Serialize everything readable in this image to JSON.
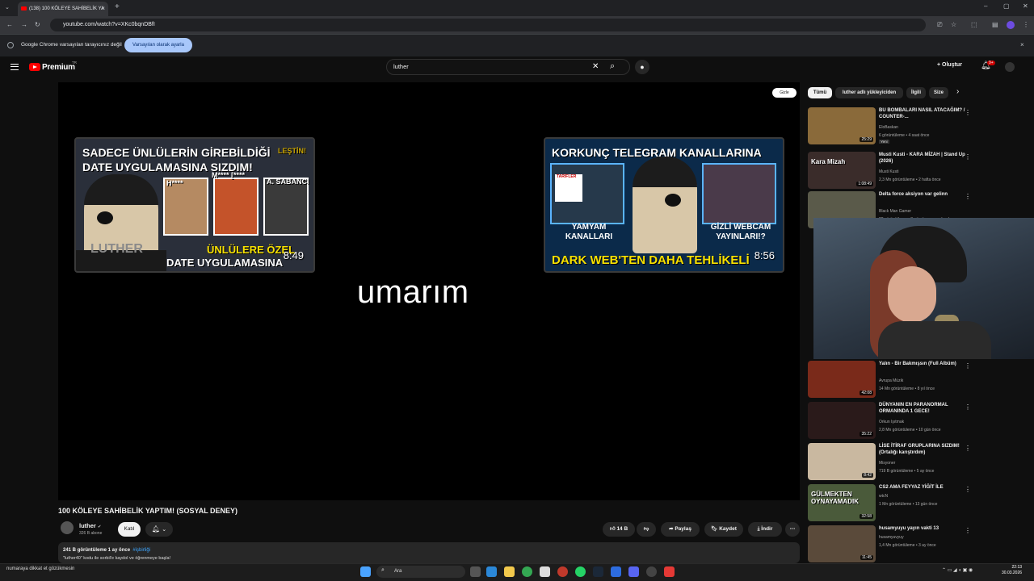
{
  "browser": {
    "tab_title": "(138) 100 KÖLEYE SAHİBELİK YA",
    "tab_close": "×",
    "new_tab": "+",
    "url": "youtube.com/watch?v=XKc0bqnDBfI",
    "infobar_text": "Google Chrome varsayılan tarayıcınız değil",
    "infobar_button": "Varsayılan olarak ayarla",
    "infobar_close": "×",
    "window_controls": {
      "minimize": "–",
      "maximize": "▢",
      "close": "✕"
    }
  },
  "header": {
    "brand": "Premium",
    "region": "TR",
    "search_value": "luther",
    "create_label": "Oluştur",
    "notif_count": "9+"
  },
  "player": {
    "hide_label": "Gizle",
    "caption": "umarım",
    "card1": {
      "title": "SADECE ÜNLÜLERİN GİREBİLDİĞİ DATE UYGULAMASINA SIZDIM!",
      "corner": "LEŞTİN!",
      "face_label": "LUTHER",
      "p1": "H****",
      "p2": "M**** [****",
      "p3": "A. SABANCI",
      "bottom1": "ÜNLÜLERE ÖZEL",
      "bottom2": "DATE UYGULAMASINA SIZDIM!",
      "duration": "8:49"
    },
    "card2": {
      "title": "KORKUNÇ TELEGRAM KANALLARINA SIZDIM!",
      "tile1": "YAMYAM KANALLARI",
      "tile2": "GİZLİ WEBCAM YAYINLARI!?",
      "tile_tag": "TARİFLER",
      "bottom": "DARK WEB'TEN DAHA TEHLİKELİ",
      "duration": "8:56"
    }
  },
  "video": {
    "title": "100 KÖLEYE SAHİBELİK YAPTIM! (SOSYAL DENEY)",
    "channel": "luther",
    "subs": "326 B abone",
    "join": "Katıl",
    "likes": "14 B",
    "share": "Paylaş",
    "save": "Kaydet",
    "download": "İndir",
    "more": "⋯",
    "desc_stats": "241 B görüntüleme  1 ay önce",
    "desc_tag": "#işbirliği",
    "desc_line": "\"luther40\" kodu ile sorbil'e kaydol ve öğrenmeye başla!"
  },
  "chips": [
    "Tümü",
    "luther adlı yükleyiciden",
    "İlgili",
    "Size"
  ],
  "recommendations": [
    {
      "title": "BU BOMBALARI NASIL ATACAĞIM? / COUNTER-...",
      "channel": "EloBaskan",
      "meta": "6 görüntüleme • 4 saat önce",
      "badge": "Yeni",
      "duration": "25:29",
      "color": "#8a6a3a"
    },
    {
      "title": "Musti Kusti - KARA MİZAH | Stand Up (2026)",
      "channel": "Musti Kusti",
      "meta": "2,3 Mn görüntüleme • 2 hafta önce",
      "badge": "",
      "duration": "1:08:49",
      "color": "#3a2c2a",
      "thumb_text": "Kara Mizah"
    },
    {
      "title": "Delta force aksiyon var gelinn",
      "channel": "Black Man Gamer",
      "meta": "28 görüntüleme • 3 gün önce yayınlandı",
      "badge": "",
      "duration": "",
      "color": "#5a5a4a"
    },
    {
      "title": "Yalın - Bir Bakmışsın (Full Albüm)",
      "channel": "Avrupa Müzik",
      "meta": "14 Mn görüntüleme • 8 yıl önce",
      "badge": "",
      "duration": "42:08",
      "color": "#7a2a1a"
    },
    {
      "title": "DÜNYANIN EN PARANORMAL ORMANINDA 1 GECE!",
      "channel": "Orkun Işıtmak",
      "meta": "2,8 Mn görüntüleme • 10 gün önce",
      "badge": "",
      "duration": "35:22",
      "color": "#2a1a1a"
    },
    {
      "title": "LİSE İTİRAF GRUPLARINA SIZDIM! (Ortalığı karıştırdım)",
      "channel": "Misyoner",
      "meta": "719 B görüntüleme • 5 ay önce",
      "badge": "",
      "duration": "8:42",
      "color": "#c9b8a0"
    },
    {
      "title": "CS2 AMA FEYYAZ YİĞİT İLE",
      "channel": "wtcN",
      "meta": "1 Mn görüntüleme • 13 gün önce",
      "badge": "",
      "duration": "32:58",
      "color": "#4a5a3a",
      "thumb_text": "GÜLMEKTEN OYNAYAMADIK"
    },
    {
      "title": "husamyuyu yayın vakti 13",
      "channel": "husamyuvyuy",
      "meta": "1,4 Mn görüntüleme • 3 ay önce",
      "badge": "",
      "duration": "11:45",
      "color": "#5a4a3a"
    }
  ],
  "taskbar": {
    "note": "numaraya dikkat et gözükmesin",
    "search": "Ara",
    "time": "22:13",
    "date": "30.03.2026"
  },
  "colors": {
    "yt_red": "#ff0000",
    "accent_blue": "#a8c7fa",
    "bg": "#0f0f0f"
  }
}
